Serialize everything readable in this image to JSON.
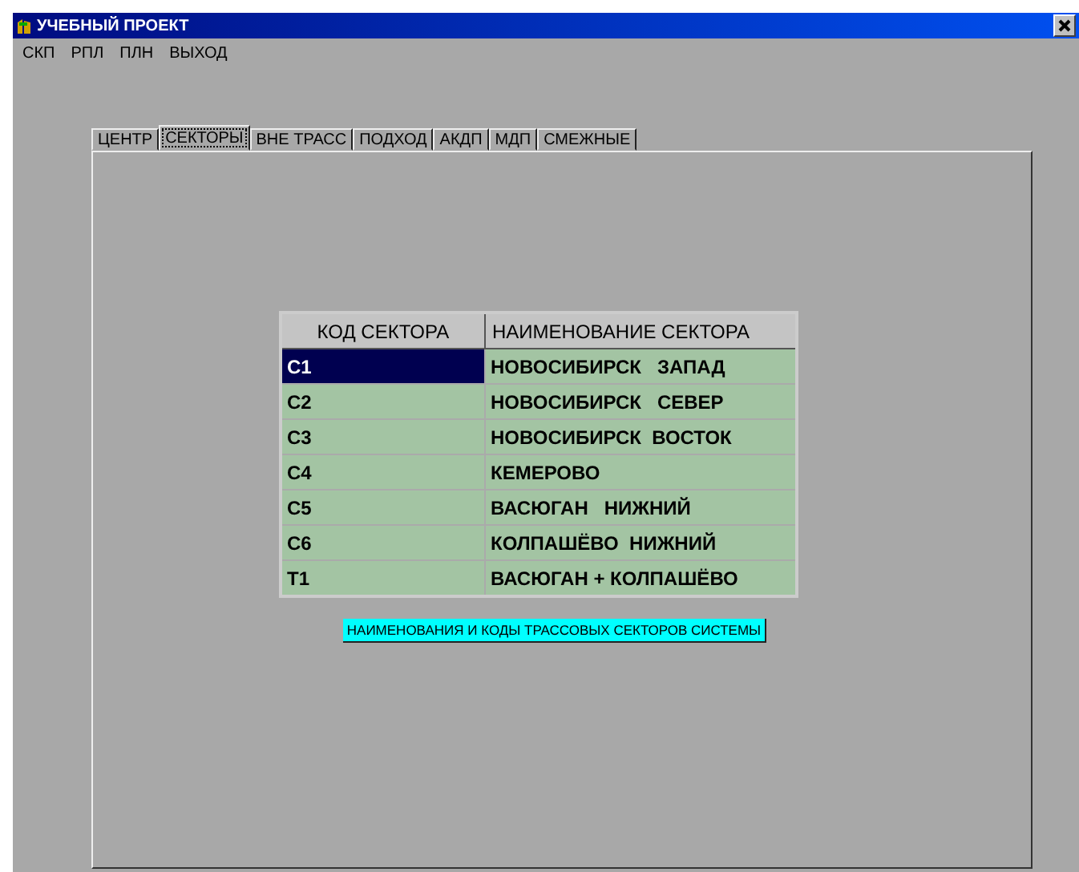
{
  "window": {
    "title": "УЧЕБНЫЙ ПРОЕКТ"
  },
  "menu": [
    "СКП",
    "РПЛ",
    "ПЛН",
    "ВЫХОД"
  ],
  "tabs": [
    {
      "label": "ЦЕНТР",
      "selected": false
    },
    {
      "label": "СЕКТОРЫ",
      "selected": true
    },
    {
      "label": "ВНЕ ТРАСС",
      "selected": false
    },
    {
      "label": "ПОДХОД",
      "selected": false
    },
    {
      "label": "АКДП",
      "selected": false
    },
    {
      "label": "МДП",
      "selected": false
    },
    {
      "label": "СМЕЖНЫЕ",
      "selected": false
    }
  ],
  "table": {
    "columns": [
      "КОД СЕКТОРА",
      "НАИМЕНОВАНИЕ СЕКТОРА"
    ],
    "rows": [
      {
        "code": "С1",
        "name": "НОВОСИБИРСК   ЗАПАД",
        "selected": true
      },
      {
        "code": "С2",
        "name": "НОВОСИБИРСК   СЕВЕР",
        "selected": false
      },
      {
        "code": "С3",
        "name": "НОВОСИБИРСК  ВОСТОК",
        "selected": false
      },
      {
        "code": "С4",
        "name": "КЕМЕРОВО",
        "selected": false
      },
      {
        "code": "С5",
        "name": "ВАСЮГАН   НИЖНИЙ",
        "selected": false
      },
      {
        "code": "С6",
        "name": "КОЛПАШЁВО  НИЖНИЙ",
        "selected": false
      },
      {
        "code": "Т1",
        "name": "ВАСЮГАН + КОЛПАШЁВО",
        "selected": false
      }
    ]
  },
  "caption": "НАИМЕНОВАНИЯ И КОДЫ ТРАССОВЫХ СЕКТОРОВ СИСТЕМЫ"
}
